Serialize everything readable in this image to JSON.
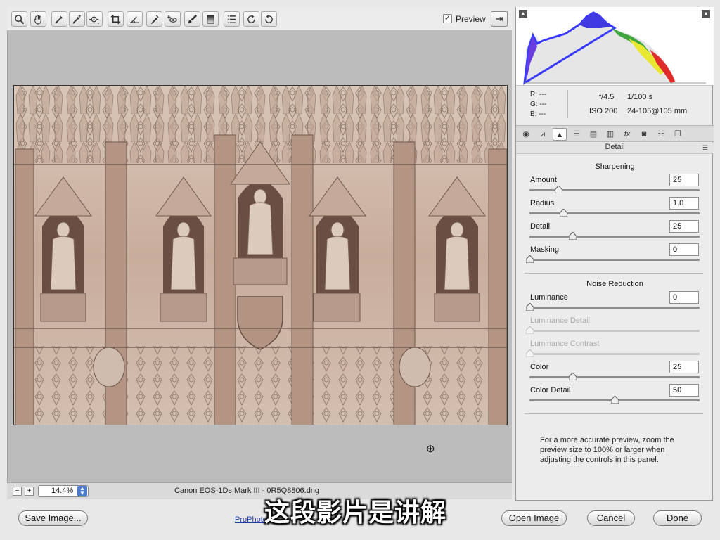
{
  "toolbar": {
    "tools": [
      "zoom-tool-icon",
      "hand-tool-icon",
      "white-balance-tool-icon",
      "color-sampler-tool-icon",
      "targeted-adjustment-tool-icon",
      "crop-tool-icon",
      "straighten-tool-icon",
      "spot-removal-tool-icon",
      "red-eye-removal-tool-icon",
      "adjustment-brush-icon",
      "graduated-filter-icon",
      "preferences-icon",
      "rotate-left-icon",
      "rotate-right-icon"
    ],
    "preview_label": "Preview",
    "preview_checked": true
  },
  "status": {
    "zoom_minus": "−",
    "zoom_plus": "+",
    "zoom_value": "14.4%",
    "camera_info": "Canon EOS-1Ds Mark III  -  0R5Q8806.dng"
  },
  "histogram": {
    "readout": {
      "r": "R:  ---",
      "g": "G:  ---",
      "b": "B:  ---"
    },
    "aperture": "f/4.5",
    "shutter": "1/100 s",
    "iso": "ISO 200",
    "lens": "24-105@105 mm"
  },
  "panel": {
    "tabs": [
      "basic-tab-icon",
      "tone-curve-tab-icon",
      "detail-tab-icon",
      "hsl-tab-icon",
      "split-toning-tab-icon",
      "lens-corrections-tab-icon",
      "effects-tab-icon",
      "camera-calibration-tab-icon",
      "presets-tab-icon",
      "snapshots-tab-icon"
    ],
    "title": "Detail",
    "sharpening": {
      "heading": "Sharpening",
      "amount": {
        "label": "Amount",
        "value": "25",
        "fraction": 0.17
      },
      "radius": {
        "label": "Radius",
        "value": "1.0",
        "fraction": 0.2
      },
      "detail": {
        "label": "Detail",
        "value": "25",
        "fraction": 0.25
      },
      "masking": {
        "label": "Masking",
        "value": "0",
        "fraction": 0.0
      }
    },
    "noise": {
      "heading": "Noise Reduction",
      "luminance": {
        "label": "Luminance",
        "value": "0",
        "fraction": 0.0
      },
      "luminance_detail": {
        "label": "Luminance Detail",
        "fraction": 0.0
      },
      "luminance_contrast": {
        "label": "Luminance Contrast",
        "fraction": 0.0
      },
      "color": {
        "label": "Color",
        "value": "25",
        "fraction": 0.25
      },
      "color_detail": {
        "label": "Color Detail",
        "value": "50",
        "fraction": 0.5
      }
    },
    "help_text": "For a more accurate preview, zoom the preview size to 100% or larger when adjusting the controls in this panel."
  },
  "bottom": {
    "save_image": "Save Image...",
    "workflow_link": "ProPhoto",
    "open_image": "Open Image",
    "cancel": "Cancel",
    "done": "Done"
  },
  "subtitle": "这段影片是讲解"
}
